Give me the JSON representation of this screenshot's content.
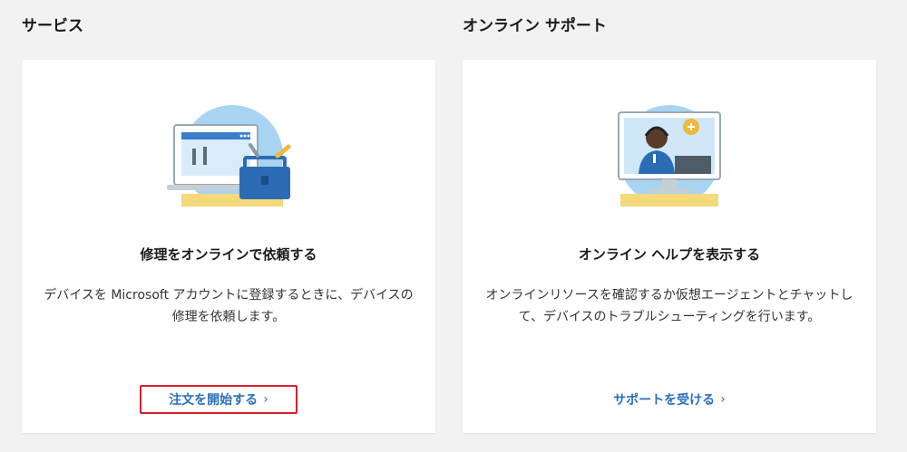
{
  "services": {
    "heading": "サービス",
    "card": {
      "illustration": "repair-toolbox-laptop-illustration",
      "title": "修理をオンラインで依頼する",
      "description_line1": "デバイスを Microsoft アカウントに登録するときに、デバイスの",
      "description_line2": "修理を依頼します。",
      "link_label": "注文を開始する",
      "link_chevron": "›"
    }
  },
  "support": {
    "heading": "オンライン サポート",
    "card": {
      "illustration": "support-agent-monitor-illustration",
      "title": "オンライン ヘルプを表示する",
      "description_line1": "オンラインリソースを確認するか仮想エージェントとチャットし",
      "description_line2": "て、デバイスのトラブルシューティングを行います。",
      "link_label": "サポートを受ける",
      "link_chevron": "›"
    }
  },
  "colors": {
    "link": "#2a6fbd",
    "highlight_border": "#d9202a",
    "page_bg": "#f2f2f2",
    "card_bg": "#ffffff"
  }
}
